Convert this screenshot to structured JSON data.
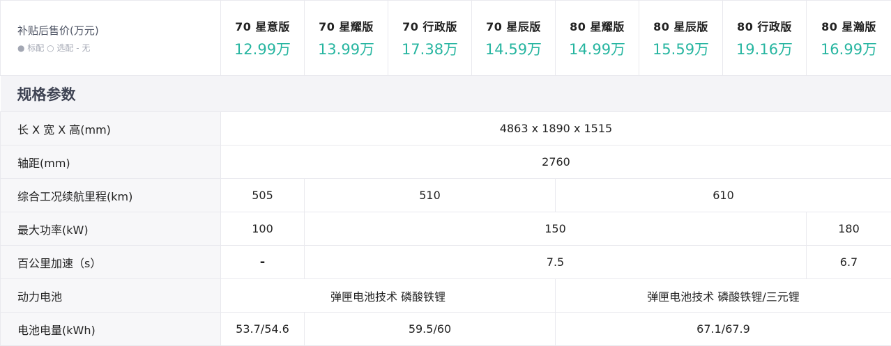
{
  "header": {
    "title": "补贴后售价(万元)",
    "legend": "● 标配 ○ 选配 - 无"
  },
  "models": [
    {
      "name": "70 星意版",
      "price": "12.99万"
    },
    {
      "name": "70 星耀版",
      "price": "13.99万"
    },
    {
      "name": "70 行政版",
      "price": "17.38万"
    },
    {
      "name": "70 星辰版",
      "price": "14.59万"
    },
    {
      "name": "80 星耀版",
      "price": "14.99万"
    },
    {
      "name": "80 星辰版",
      "price": "15.59万"
    },
    {
      "name": "80 行政版",
      "price": "19.16万"
    },
    {
      "name": "80 星瀚版",
      "price": "16.99万"
    }
  ],
  "section": {
    "title": "规格参数"
  },
  "rows": [
    {
      "label": "长 X 宽 X 高(mm)",
      "cells": [
        "4863 x 1890 x 1515"
      ]
    },
    {
      "label": "轴距(mm)",
      "cells": [
        "2760"
      ]
    },
    {
      "label": "综合工况续航里程(km)",
      "cells": [
        "505",
        "510",
        "610"
      ]
    },
    {
      "label": "最大功率(kW)",
      "cells": [
        "100",
        "150",
        "180"
      ]
    },
    {
      "label": "百公里加速（s）",
      "cells": [
        "-",
        "7.5",
        "6.7"
      ]
    },
    {
      "label": "动力电池",
      "cells": [
        "弹匣电池技术 磷酸铁锂",
        "弹匣电池技术 磷酸铁锂/三元锂"
      ]
    },
    {
      "label": "电池电量(kWh)",
      "cells": [
        "53.7/54.6",
        "59.5/60",
        "67.1/67.9"
      ]
    }
  ],
  "colors": {
    "price_accent": "#26b5a0",
    "section_bg": "#f4f4f7",
    "border": "#e9e9ee"
  }
}
